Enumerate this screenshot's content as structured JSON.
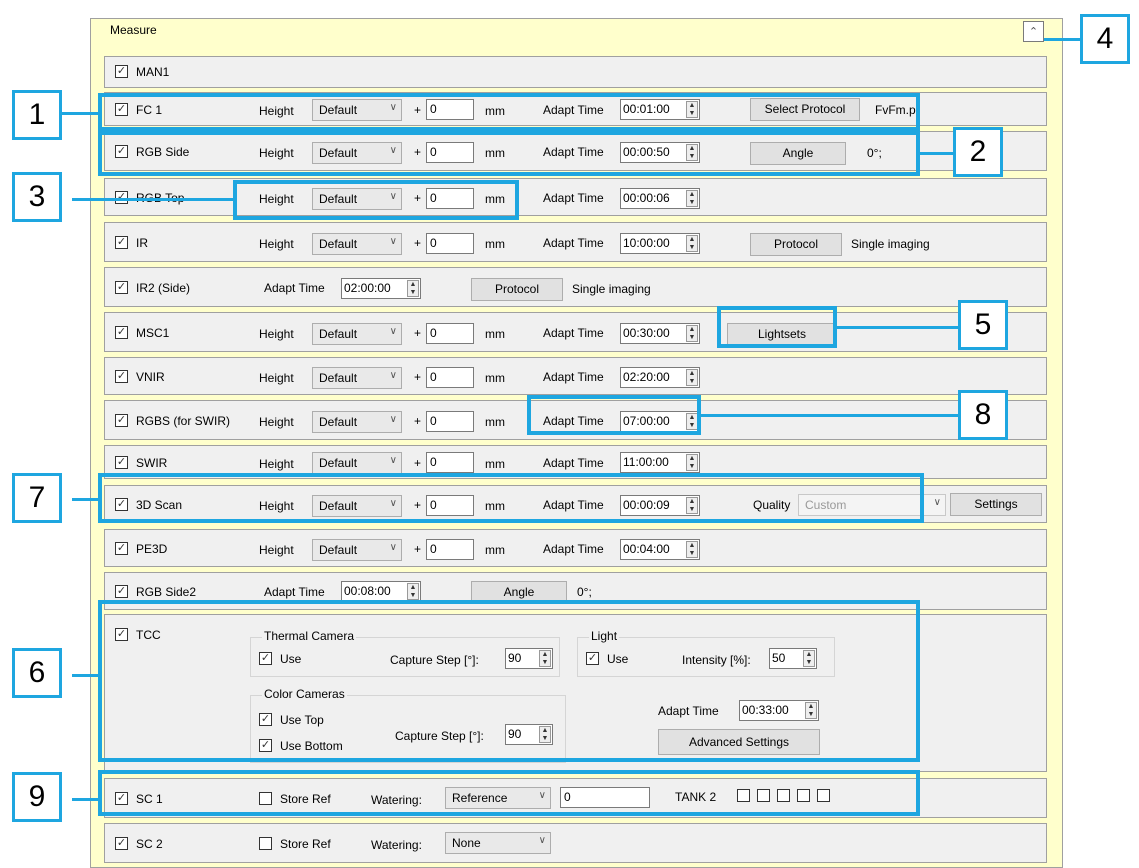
{
  "panel": {
    "title": "Measure",
    "collapse_icon": "chevron-up-icon"
  },
  "rows": [
    {
      "id": "man1",
      "label": "MAN1"
    },
    {
      "id": "fc1",
      "label": "FC 1",
      "height_label": "Height",
      "height_value": "Default",
      "plus": "+",
      "offset": "0",
      "unit": "mm",
      "adapt_label": "Adapt Time",
      "adapt_value": "00:01:00",
      "button": "Select Protocol",
      "note": "FvFm.p"
    },
    {
      "id": "rgbside",
      "label": "RGB Side",
      "height_label": "Height",
      "height_value": "Default",
      "plus": "+",
      "offset": "0",
      "unit": "mm",
      "adapt_label": "Adapt Time",
      "adapt_value": "00:00:50",
      "button": "Angle",
      "note": "0°;"
    },
    {
      "id": "rgbtop",
      "label": "RGB Top",
      "height_label": "Height",
      "height_value": "Default",
      "plus": "+",
      "offset": "0",
      "unit": "mm",
      "adapt_label": "Adapt Time",
      "adapt_value": "00:00:06"
    },
    {
      "id": "ir",
      "label": "IR",
      "height_label": "Height",
      "height_value": "Default",
      "plus": "+",
      "offset": "0",
      "unit": "mm",
      "adapt_label": "Adapt Time",
      "adapt_value": "10:00:00",
      "button": "Protocol",
      "note": "Single imaging"
    },
    {
      "id": "ir2",
      "label": "IR2 (Side)",
      "adapt_label": "Adapt Time",
      "adapt_value": "02:00:00",
      "button": "Protocol",
      "note": "Single imaging"
    },
    {
      "id": "msc1",
      "label": "MSC1",
      "height_label": "Height",
      "height_value": "Default",
      "plus": "+",
      "offset": "0",
      "unit": "mm",
      "adapt_label": "Adapt Time",
      "adapt_value": "00:30:00",
      "button": "Lightsets"
    },
    {
      "id": "vnir",
      "label": "VNIR",
      "height_label": "Height",
      "height_value": "Default",
      "plus": "+",
      "offset": "0",
      "unit": "mm",
      "adapt_label": "Adapt Time",
      "adapt_value": "02:20:00"
    },
    {
      "id": "rgbs",
      "label": "RGBS (for SWIR)",
      "height_label": "Height",
      "height_value": "Default",
      "plus": "+",
      "offset": "0",
      "unit": "mm",
      "adapt_label": "Adapt Time",
      "adapt_value": "07:00:00"
    },
    {
      "id": "swir",
      "label": "SWIR",
      "height_label": "Height",
      "height_value": "Default",
      "plus": "+",
      "offset": "0",
      "unit": "mm",
      "adapt_label": "Adapt Time",
      "adapt_value": "11:00:00"
    },
    {
      "id": "scan3d",
      "label": "3D Scan",
      "height_label": "Height",
      "height_value": "Default",
      "plus": "+",
      "offset": "0",
      "unit": "mm",
      "adapt_label": "Adapt Time",
      "adapt_value": "00:00:09",
      "quality_label": "Quality",
      "quality_value": "Custom",
      "button": "Settings"
    },
    {
      "id": "pe3d",
      "label": "PE3D",
      "height_label": "Height",
      "height_value": "Default",
      "plus": "+",
      "offset": "0",
      "unit": "mm",
      "adapt_label": "Adapt Time",
      "adapt_value": "00:04:00"
    },
    {
      "id": "rgbside2",
      "label": "RGB Side2",
      "adapt_label": "Adapt Time",
      "adapt_value": "00:08:00",
      "button": "Angle",
      "note": "0°;"
    }
  ],
  "tcc": {
    "label": "TCC",
    "thermal": {
      "title": "Thermal Camera",
      "use": "Use",
      "step_label": "Capture Step [°]:",
      "step_value": "90"
    },
    "light": {
      "title": "Light",
      "use": "Use",
      "intensity_label": "Intensity [%]:",
      "intensity_value": "50"
    },
    "color": {
      "title": "Color Cameras",
      "use_top": "Use Top",
      "use_bottom": "Use Bottom",
      "step_label": "Capture Step [°]:",
      "step_value": "90"
    },
    "adapt_label": "Adapt Time",
    "adapt_value": "00:33:00",
    "advanced": "Advanced Settings"
  },
  "sc1": {
    "label": "SC 1",
    "store_ref": "Store Ref",
    "watering_label": "Watering:",
    "watering_value": "Reference",
    "amount": "0",
    "tank_label": "TANK 2"
  },
  "sc2": {
    "label": "SC 2",
    "store_ref": "Store Ref",
    "watering_label": "Watering:",
    "watering_value": "None"
  },
  "callouts": [
    "1",
    "2",
    "3",
    "4",
    "5",
    "6",
    "7",
    "8",
    "9"
  ],
  "colors": {
    "panel": "#ffffcc",
    "row": "#f0f0f0",
    "highlight": "#1ea6e0"
  }
}
